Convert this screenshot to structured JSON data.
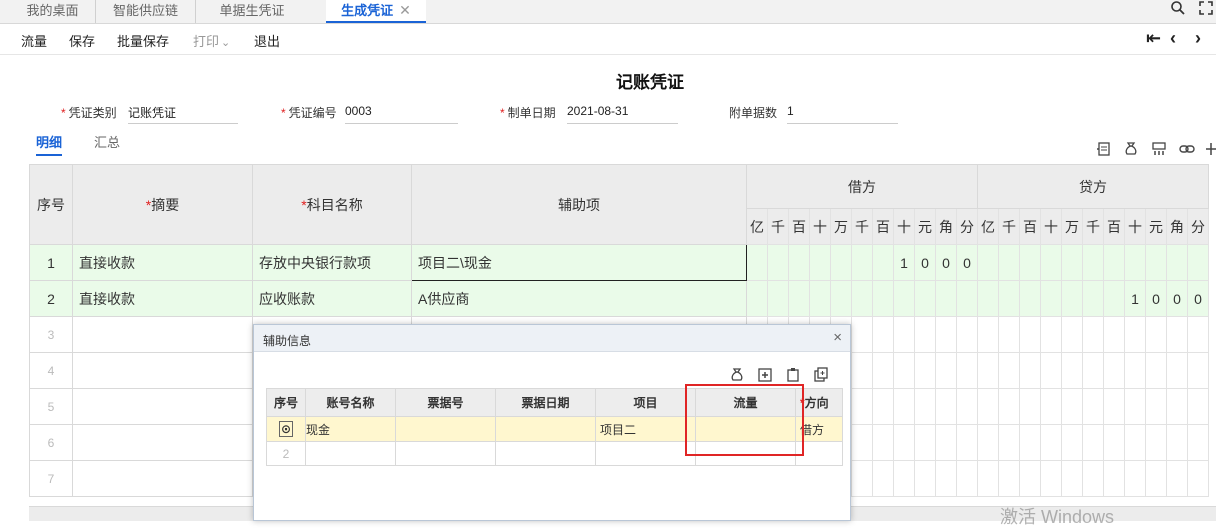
{
  "tabs": [
    {
      "label": "我的桌面"
    },
    {
      "label": "智能供应链"
    },
    {
      "label": "单据生凭证"
    },
    {
      "label": "生成凭证",
      "close": "✕"
    }
  ],
  "toolbar": {
    "flow": "流量",
    "save": "保存",
    "batch_save": "批量保存",
    "print": "打印",
    "print_caret": "⌄",
    "exit": "退出",
    "nav_first": "⇤",
    "nav_prev": "‹",
    "nav_next": "›"
  },
  "voucher": {
    "title": "记账凭证",
    "type_label": "凭证类别",
    "type_value": "记账凭证",
    "no_label": "凭证编号",
    "no_value": "0003",
    "date_label": "制单日期",
    "date_value": "2021-08-31",
    "attach_label": "附单据数",
    "attach_value": "1",
    "req_mark": "*"
  },
  "subtabs": {
    "detail": "明细",
    "summary": "汇总"
  },
  "grid": {
    "headers": {
      "seq": "序号",
      "summary": "摘要",
      "account": "科目名称",
      "aux": "辅助项",
      "debit": "借方",
      "credit": "贷方"
    },
    "digits": [
      "亿",
      "千",
      "百",
      "十",
      "万",
      "千",
      "百",
      "十",
      "元",
      "角",
      "分"
    ],
    "rows": [
      {
        "seq": "1",
        "summary": "直接收款",
        "account": "存放中央银行款项",
        "aux": "项目二\\现金",
        "debit": [
          "",
          "",
          "",
          "",
          "",
          "",
          "",
          "1",
          "0",
          "0",
          "0"
        ],
        "credit": [
          "",
          "",
          "",
          "",
          "",
          "",
          "",
          "",
          "",
          "",
          ""
        ]
      },
      {
        "seq": "2",
        "summary": "直接收款",
        "account": "应收账款",
        "aux": "A供应商",
        "debit": [
          "",
          "",
          "",
          "",
          "",
          "",
          "",
          "",
          "",
          "",
          ""
        ],
        "credit": [
          "",
          "",
          "",
          "",
          "",
          "",
          "",
          "1",
          "0",
          "0",
          "0"
        ]
      }
    ],
    "blank_rows": [
      "3",
      "4",
      "5",
      "6",
      "7"
    ]
  },
  "dialog": {
    "title": "辅助信息",
    "close": "×",
    "headers": {
      "seq": "序号",
      "account_name": "账号名称",
      "bill_no": "票据号",
      "bill_date": "票据日期",
      "project": "项目",
      "flow": "流量",
      "direction": "方向"
    },
    "rows": [
      {
        "account_name": "现金",
        "bill_no": "",
        "bill_date": "",
        "project": "项目二",
        "flow": "",
        "direction": "借方"
      }
    ],
    "empty_row_seq": "2"
  },
  "watermark": "激活 Windows",
  "colors": {
    "accent": "#1a63d6",
    "row_green": "#eafbe9",
    "row_selected": "#fff7cf",
    "required": "#e02020",
    "highlight": "#e02525"
  }
}
